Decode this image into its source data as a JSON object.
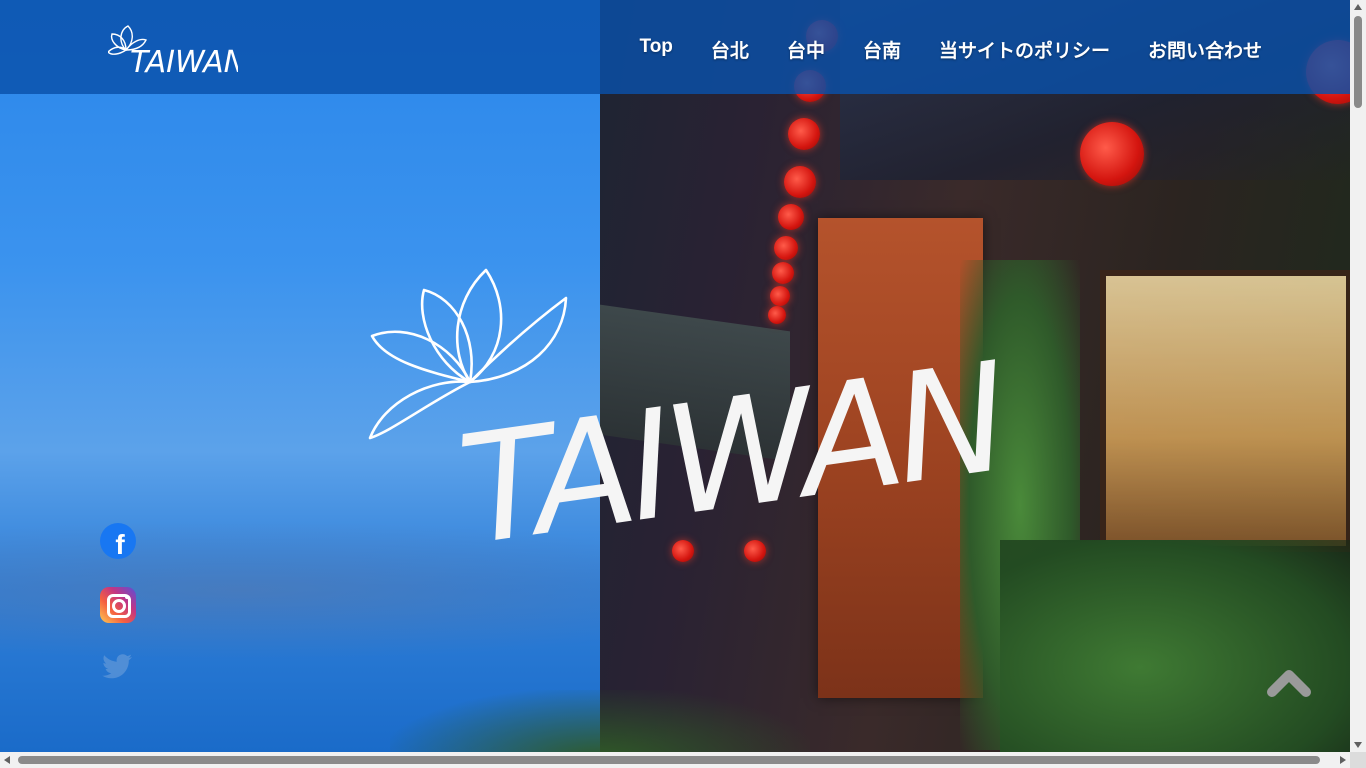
{
  "header": {
    "brand": {
      "logo_text": "TAIWAN",
      "icon": "lotus-icon"
    },
    "nav": [
      {
        "label": "Top"
      },
      {
        "label": "台北"
      },
      {
        "label": "台中"
      },
      {
        "label": "台南"
      },
      {
        "label": "当サイトのポリシー"
      },
      {
        "label": "お問い合わせ"
      }
    ]
  },
  "hero": {
    "logo_text": "TAIWAN",
    "logo_icon": "lotus-icon",
    "background": "night-street-lanterns-photo"
  },
  "social": [
    {
      "name": "facebook",
      "icon": "facebook-icon",
      "glyph": "f",
      "color": "#1877f2"
    },
    {
      "name": "instagram",
      "icon": "instagram-icon"
    },
    {
      "name": "twitter",
      "icon": "twitter-icon"
    }
  ],
  "back_to_top": {
    "icon": "chevron-up-icon"
  },
  "colors": {
    "header_bg": "#0a50aa",
    "nav_text": "#ffffff",
    "sky": "#2a86ea"
  }
}
